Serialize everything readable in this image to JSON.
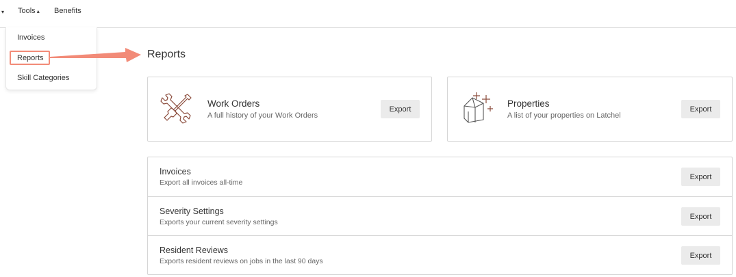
{
  "nav": {
    "caret": "▾",
    "tools_label": "Tools",
    "tools_caret": "▴",
    "benefits_label": "Benefits"
  },
  "dropdown": {
    "items": [
      {
        "label": "Invoices"
      },
      {
        "label": "Reports"
      },
      {
        "label": "Skill Categories"
      }
    ]
  },
  "page": {
    "title": "Reports"
  },
  "cards": [
    {
      "title": "Work Orders",
      "subtitle": "A full history of your Work Orders",
      "button": "Export",
      "icon": "tools-icon"
    },
    {
      "title": "Properties",
      "subtitle": "A list of your properties on Latchel",
      "button": "Export",
      "icon": "house-icon"
    }
  ],
  "rows": [
    {
      "title": "Invoices",
      "subtitle": "Export all invoices all-time",
      "button": "Export"
    },
    {
      "title": "Severity Settings",
      "subtitle": "Exports your current severity settings",
      "button": "Export"
    },
    {
      "title": "Resident Reviews",
      "subtitle": "Exports resident reviews on jobs in the last 90 days",
      "button": "Export"
    }
  ],
  "colors": {
    "highlight": "#f28b78",
    "button_bg": "#ebebeb",
    "border": "#d6d6d6"
  }
}
